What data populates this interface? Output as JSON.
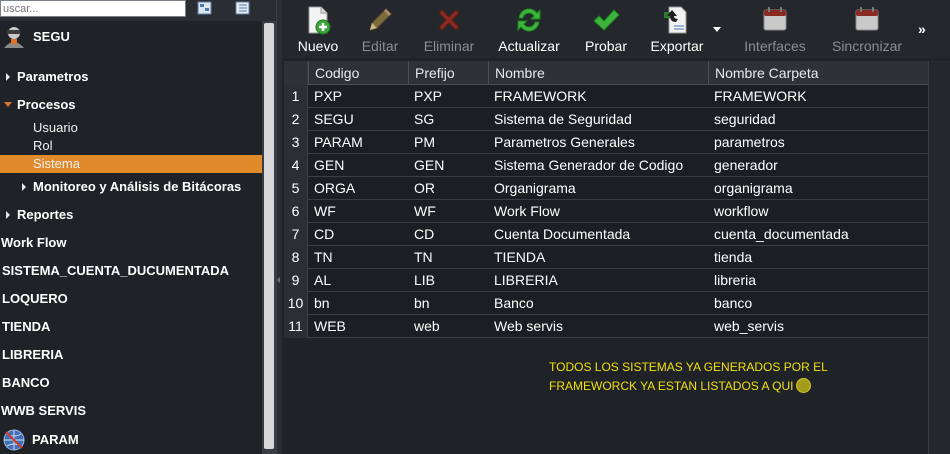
{
  "search": {
    "placeholder": "uscar..."
  },
  "tree": {
    "root_label": "SEGU",
    "items": [
      {
        "label": "Parametros"
      },
      {
        "label": "Procesos"
      },
      {
        "label": "Usuario"
      },
      {
        "label": "Rol"
      },
      {
        "label": "Sistema"
      },
      {
        "label": "Monitoreo y Análisis de Bitácoras"
      },
      {
        "label": "Reportes"
      },
      {
        "label": "Work Flow"
      },
      {
        "label": "SISTEMA_CUENTA_DUCUMENTADA"
      },
      {
        "label": "LOQUERO"
      },
      {
        "label": "TIENDA"
      },
      {
        "label": "LIBRERIA"
      },
      {
        "label": "BANCO"
      },
      {
        "label": "WWB SERVIS"
      },
      {
        "label": "PARAM"
      }
    ]
  },
  "toolbar": {
    "nuevo": "Nuevo",
    "editar": "Editar",
    "eliminar": "Eliminar",
    "actualizar": "Actualizar",
    "probar": "Probar",
    "exportar": "Exportar",
    "interfaces": "Interfaces",
    "sincronizar": "Sincronizar",
    "more": "»"
  },
  "grid": {
    "columns": [
      "Codigo",
      "Prefijo",
      "Nombre",
      "Nombre Carpeta"
    ],
    "rows": [
      {
        "n": "1",
        "codigo": "PXP",
        "prefijo": "PXP",
        "nombre": "FRAMEWORK",
        "carpeta": "FRAMEWORK"
      },
      {
        "n": "2",
        "codigo": "SEGU",
        "prefijo": "SG",
        "nombre": "Sistema de Seguridad",
        "carpeta": "seguridad"
      },
      {
        "n": "3",
        "codigo": "PARAM",
        "prefijo": "PM",
        "nombre": "Parametros Generales",
        "carpeta": "parametros"
      },
      {
        "n": "4",
        "codigo": "GEN",
        "prefijo": "GEN",
        "nombre": "Sistema Generador de Codigo",
        "carpeta": "generador"
      },
      {
        "n": "5",
        "codigo": "ORGA",
        "prefijo": "OR",
        "nombre": "Organigrama",
        "carpeta": "organigrama"
      },
      {
        "n": "6",
        "codigo": "WF",
        "prefijo": "WF",
        "nombre": "Work Flow",
        "carpeta": "workflow"
      },
      {
        "n": "7",
        "codigo": "CD",
        "prefijo": "CD",
        "nombre": "Cuenta Documentada",
        "carpeta": "cuenta_documentada"
      },
      {
        "n": "8",
        "codigo": "TN",
        "prefijo": "TN",
        "nombre": "TIENDA",
        "carpeta": "tienda"
      },
      {
        "n": "9",
        "codigo": "AL",
        "prefijo": "LIB",
        "nombre": "LIBRERIA",
        "carpeta": "libreria"
      },
      {
        "n": "10",
        "codigo": "bn",
        "prefijo": "bn",
        "nombre": "Banco",
        "carpeta": "banco"
      },
      {
        "n": "11",
        "codigo": "WEB",
        "prefijo": "web",
        "nombre": "Web servis",
        "carpeta": "web_servis"
      }
    ]
  },
  "note": {
    "line1": "TODOS LOS SISTEMAS YA GENERADOS POR EL",
    "line2": "FRAMEWORCK YA ESTAN LISTADOS A QUI"
  },
  "colors": {
    "selected": "#e08a2c",
    "note": "#f0e00c",
    "background": "#1f2226"
  }
}
